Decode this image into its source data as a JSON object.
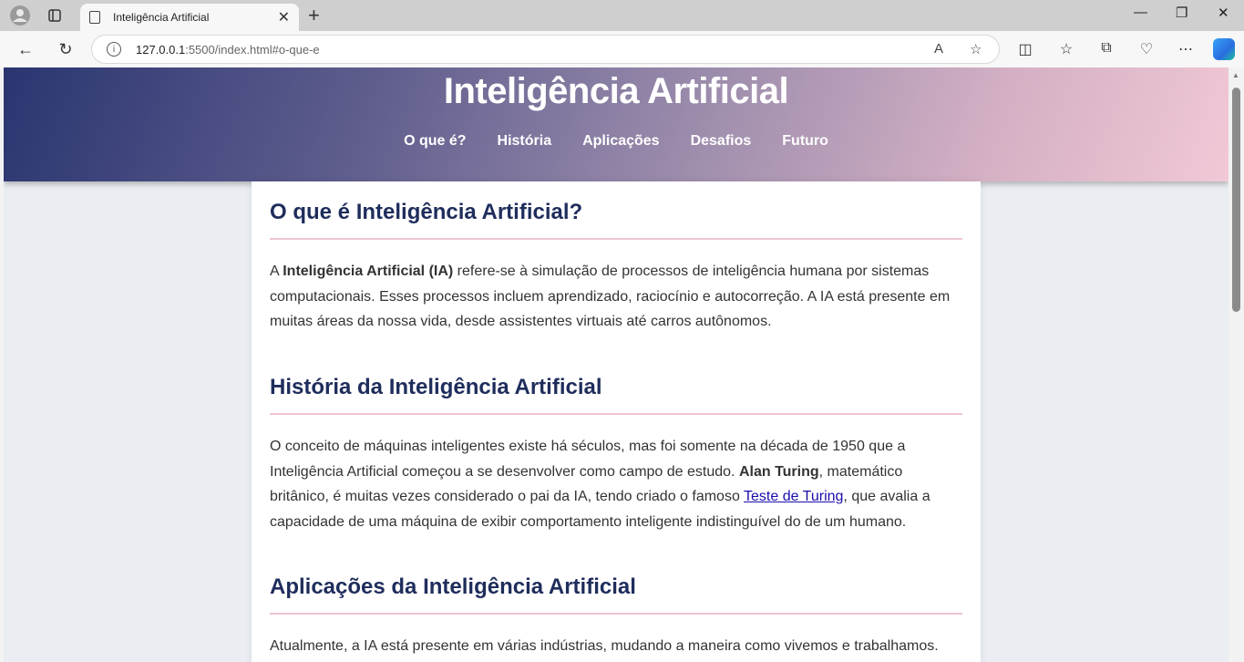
{
  "browser": {
    "tab_title": "Inteligência Artificial",
    "url_host": "127.0.0.1",
    "url_rest": ":5500/index.html#o-que-e"
  },
  "header": {
    "title": "Inteligência Artificial",
    "nav": [
      "O que é?",
      "História",
      "Aplicações",
      "Desafios",
      "Futuro"
    ]
  },
  "sections": {
    "what": {
      "heading": "O que é Inteligência Artificial?",
      "p_start": "A ",
      "p_bold": "Inteligência Artificial (IA)",
      "p_end": " refere-se à simulação de processos de inteligência humana por sistemas computacionais. Esses processos incluem aprendizado, raciocínio e autocorreção. A IA está presente em muitas áreas da nossa vida, desde assistentes virtuais até carros autônomos."
    },
    "history": {
      "heading": "História da Inteligência Artificial",
      "p_start": "O conceito de máquinas inteligentes existe há séculos, mas foi somente na década de 1950 que a Inteligência Artificial começou a se desenvolver como campo de estudo. ",
      "p_bold": "Alan Turing",
      "p_mid": ", matemático britânico, é muitas vezes considerado o pai da IA, tendo criado o famoso ",
      "p_link": "Teste de Turing",
      "p_end": ", que avalia a capacidade de uma máquina de exibir comportamento inteligente indistinguível do de um humano."
    },
    "applications": {
      "heading": "Aplicações da Inteligência Artificial",
      "p": "Atualmente, a IA está presente em várias indústrias, mudando a maneira como vivemos e trabalhamos."
    }
  },
  "colors": {
    "heading": "#1f2d5c",
    "header_gradient_start": "#2a3570",
    "header_gradient_end": "#f1c8d6",
    "divider": "#f0c4d4"
  }
}
